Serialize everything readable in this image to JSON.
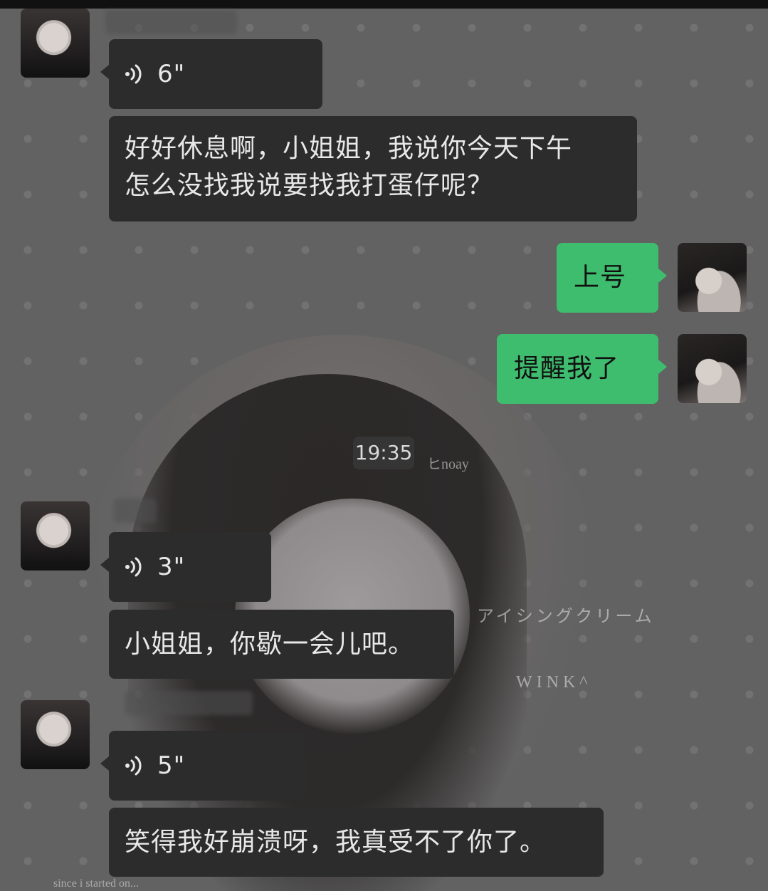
{
  "time_divider": "19:35",
  "background": {
    "texts": [
      "ヒnoay",
      "アイシングクリーム",
      "WINK^",
      "since i started on..."
    ]
  },
  "messages": [
    {
      "side": "left",
      "type": "voice",
      "duration": "6\""
    },
    {
      "side": "left",
      "type": "text",
      "lines": [
        "好好休息啊，小姐姐，我说你今天下午",
        "怎么没找我说要找我打蛋仔呢？"
      ]
    },
    {
      "side": "right",
      "type": "text",
      "text": "上号"
    },
    {
      "side": "right",
      "type": "text",
      "text": "提醒我了"
    },
    {
      "side": "left",
      "type": "voice",
      "duration": "3\""
    },
    {
      "side": "left",
      "type": "text",
      "text": "小姐姐，你歇一会儿吧。"
    },
    {
      "side": "left",
      "type": "voice",
      "duration": "5\""
    },
    {
      "side": "left",
      "type": "text",
      "text": "笑得我好崩溃呀，我真受不了你了。"
    }
  ],
  "colors": {
    "incoming_bubble": "#2c2c2c",
    "outgoing_bubble": "#3fbd6f",
    "background": "#626262"
  },
  "icons": [
    "voice-wave-icon",
    "avatar-contact",
    "avatar-self"
  ]
}
